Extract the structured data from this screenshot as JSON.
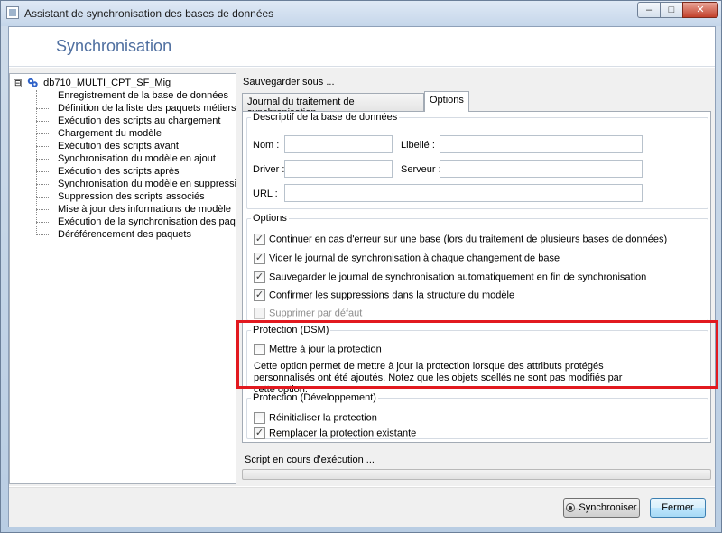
{
  "window": {
    "title": "Assistant de synchronisation des bases de données",
    "controls": {
      "minimize": "–",
      "maximize": "□",
      "close": "✕"
    }
  },
  "header": {
    "title": "Synchronisation"
  },
  "tree": {
    "root": {
      "expander": "⊟",
      "label": "db710_MULTI_CPT_SF_Mig",
      "icon": "database-icon"
    },
    "items": [
      "Enregistrement de la base de données",
      "Définition de la liste des paquets métiers",
      "Exécution des scripts au chargement",
      "Chargement du modèle",
      "Exécution des scripts avant",
      "Synchronisation du modèle en ajout",
      "Exécution des scripts après",
      "Synchronisation du modèle en suppressio",
      "Suppression des scripts associés",
      "Mise à jour des informations de modèle",
      "Exécution de la synchronisation des paque",
      "Déréférencement des paquets"
    ]
  },
  "right": {
    "save_as": "Sauvegarder sous ...",
    "tabs": [
      {
        "label": "Journal du traitement de synchronisation",
        "active": false
      },
      {
        "label": "Options",
        "active": true
      }
    ],
    "db_group": {
      "legend": "Descriptif de la base de données",
      "nom_label": "Nom :",
      "nom_value": "",
      "libelle_label": "Libellé :",
      "libelle_value": "",
      "driver_label": "Driver :",
      "driver_value": "",
      "serveur_label": "Serveur :",
      "serveur_value": "",
      "url_label": "URL :",
      "url_value": ""
    },
    "options_group": {
      "legend": "Options",
      "items": [
        {
          "label": "Continuer en cas d'erreur sur une base (lors du traitement de plusieurs bases de données)",
          "checked": true,
          "enabled": true,
          "mark": "✓"
        },
        {
          "label": "Vider le journal de synchronisation à chaque changement de base",
          "checked": true,
          "enabled": true,
          "mark": "✓"
        },
        {
          "label": "Sauvegarder le journal de synchronisation automatiquement en fin de synchronisation",
          "checked": true,
          "enabled": true,
          "mark": "✓"
        },
        {
          "label": "Confirmer les suppressions dans la structure du modèle",
          "checked": true,
          "enabled": true,
          "mark": "✓"
        },
        {
          "label": "Supprimer par défaut",
          "checked": false,
          "enabled": false,
          "mark": ""
        }
      ]
    },
    "protection_dsm": {
      "legend": "Protection (DSM)",
      "checkbox_label": "Mettre à jour la protection",
      "checked": false,
      "description": "Cette option permet de mettre à jour la protection lorsque des attributs protégés personnalisés ont été ajoutés. Notez que les objets scellés ne sont pas modifiés par cette option."
    },
    "protection_dev": {
      "legend": "Protection (Développement)",
      "items": [
        {
          "label": "Réinitialiser la protection",
          "checked": false,
          "mark": ""
        },
        {
          "label": "Remplacer la protection existante",
          "checked": true,
          "mark": "✓"
        }
      ]
    },
    "status": {
      "text": "Script en cours d'exécution ...",
      "progress": 0
    }
  },
  "footer": {
    "sync_label": "Synchroniser",
    "close_label": "Fermer"
  },
  "colors": {
    "heading": "#4f6fa0",
    "highlight": "#e2191f"
  }
}
